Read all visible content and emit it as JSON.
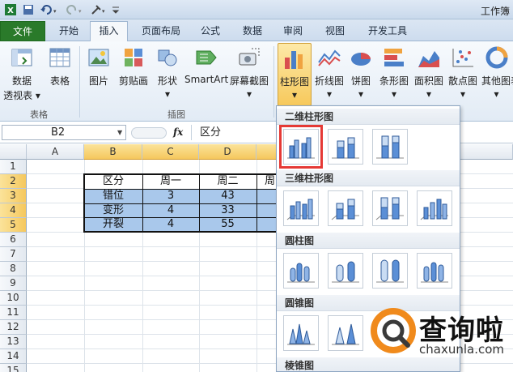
{
  "title_bar": {
    "app_title": "工作簿"
  },
  "tabs": [
    "文件",
    "开始",
    "插入",
    "页面布局",
    "公式",
    "数据",
    "审阅",
    "视图",
    "开发工具"
  ],
  "ribbon": {
    "buttons": [
      {
        "label": "数据",
        "label2": "透视表 ▾",
        "icon": "pivot-table-icon"
      },
      {
        "label": "表格",
        "label2": "",
        "icon": "table-icon"
      },
      {
        "label": "图片",
        "label2": "",
        "icon": "picture-icon"
      },
      {
        "label": "剪贴画",
        "label2": "",
        "icon": "clip-art-icon"
      },
      {
        "label": "形状",
        "label2": "▾",
        "icon": "shapes-icon"
      },
      {
        "label": "SmartArt",
        "label2": "",
        "icon": "smartart-icon"
      },
      {
        "label": "屏幕截图",
        "label2": "▾",
        "icon": "screenshot-icon"
      },
      {
        "label": "柱形图",
        "label2": "▾",
        "icon": "column-chart-icon"
      },
      {
        "label": "折线图",
        "label2": "▾",
        "icon": "line-chart-icon"
      },
      {
        "label": "饼图",
        "label2": "▾",
        "icon": "pie-chart-icon"
      },
      {
        "label": "条形图",
        "label2": "▾",
        "icon": "bar-chart-icon"
      },
      {
        "label": "面积图",
        "label2": "▾",
        "icon": "area-chart-icon"
      },
      {
        "label": "散点图",
        "label2": "▾",
        "icon": "scatter-chart-icon"
      },
      {
        "label": "其他图表",
        "label2": "▾",
        "icon": "other-charts-icon"
      }
    ],
    "groups": [
      "表格",
      "插图"
    ]
  },
  "formula_bar": {
    "name_box": "B2",
    "fx": "fx",
    "value": "区分"
  },
  "sheet": {
    "columns": [
      "A",
      "B",
      "C",
      "D"
    ],
    "rows": [
      "1",
      "2",
      "3",
      "4",
      "5",
      "6",
      "7",
      "8",
      "9",
      "10",
      "11",
      "12",
      "13",
      "14",
      "15"
    ],
    "table": {
      "header": [
        "区分",
        "周一",
        "周二",
        "周"
      ],
      "rows": [
        [
          "错位",
          "3",
          "43"
        ],
        [
          "变形",
          "4",
          "33"
        ],
        [
          "开裂",
          "4",
          "55"
        ]
      ]
    }
  },
  "gallery": {
    "sections": [
      "二维柱形图",
      "三维柱形图",
      "圆柱图",
      "圆锥图",
      "棱锥图"
    ]
  },
  "watermark": {
    "title": "查询啦",
    "subtitle": "chaxunla.com"
  },
  "colors": {
    "file_tab": "#2a7a2a",
    "selection": "#f5c85e",
    "table_fill": "#a9c8eb",
    "highlight": "#e53935",
    "chart_blue": "#5b8fd6"
  }
}
